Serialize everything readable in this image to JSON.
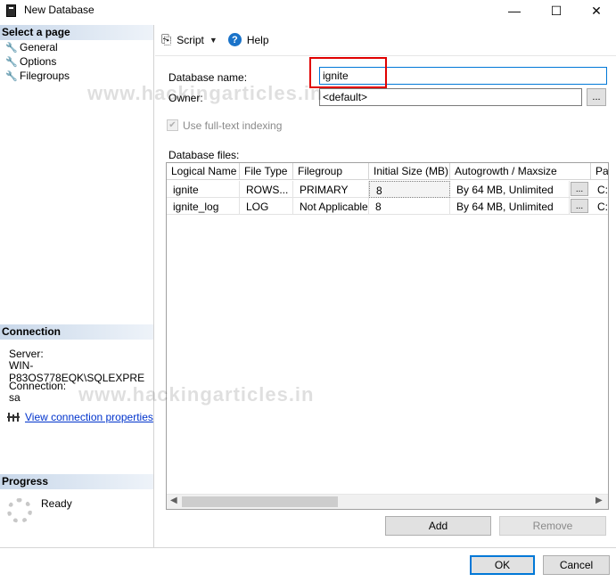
{
  "window": {
    "title": "New Database",
    "minimize_glyph": "—",
    "maximize_glyph": "☐",
    "close_glyph": "✕"
  },
  "sidebar": {
    "select_page_header": "Select a page",
    "pages": [
      {
        "label": "General",
        "icon": "wrench-icon"
      },
      {
        "label": "Options",
        "icon": "wrench-icon"
      },
      {
        "label": "Filegroups",
        "icon": "wrench-icon"
      }
    ],
    "connection": {
      "header": "Connection",
      "server_label": "Server:",
      "server_value": "WIN-P83OS778EQK\\SQLEXPRE",
      "connection_label": "Connection:",
      "connection_value": "sa",
      "view_properties_link": "View connection properties"
    },
    "progress": {
      "header": "Progress",
      "status": "Ready"
    }
  },
  "toolbar": {
    "script_label": "Script",
    "help_label": "Help"
  },
  "form": {
    "database_name_label": "Database name:",
    "database_name_value": "ignite",
    "owner_label": "Owner:",
    "owner_value": "<default>",
    "browse_label": "...",
    "fulltext_label": "Use full-text indexing",
    "fulltext_checked": true,
    "database_files_label": "Database files:"
  },
  "files_table": {
    "columns": [
      "Logical Name",
      "File Type",
      "Filegroup",
      "Initial Size (MB)",
      "Autogrowth / Maxsize",
      "Pa"
    ],
    "rows": [
      {
        "logical_name": "ignite",
        "file_type": "ROWS...",
        "filegroup": "PRIMARY",
        "initial_size": "8",
        "autogrowth": "By 64 MB, Unlimited",
        "path": "C:"
      },
      {
        "logical_name": "ignite_log",
        "file_type": "LOG",
        "filegroup": "Not Applicable",
        "initial_size": "8",
        "autogrowth": "By 64 MB, Unlimited",
        "path": "C:"
      }
    ],
    "row_button_label": "..."
  },
  "buttons": {
    "add": "Add",
    "remove": "Remove",
    "ok": "OK",
    "cancel": "Cancel"
  },
  "watermark": "www.hackingarticles.in",
  "colors": {
    "highlight_box": "#e00000",
    "link": "#0033cc",
    "section_header": "#c9d8ea"
  }
}
